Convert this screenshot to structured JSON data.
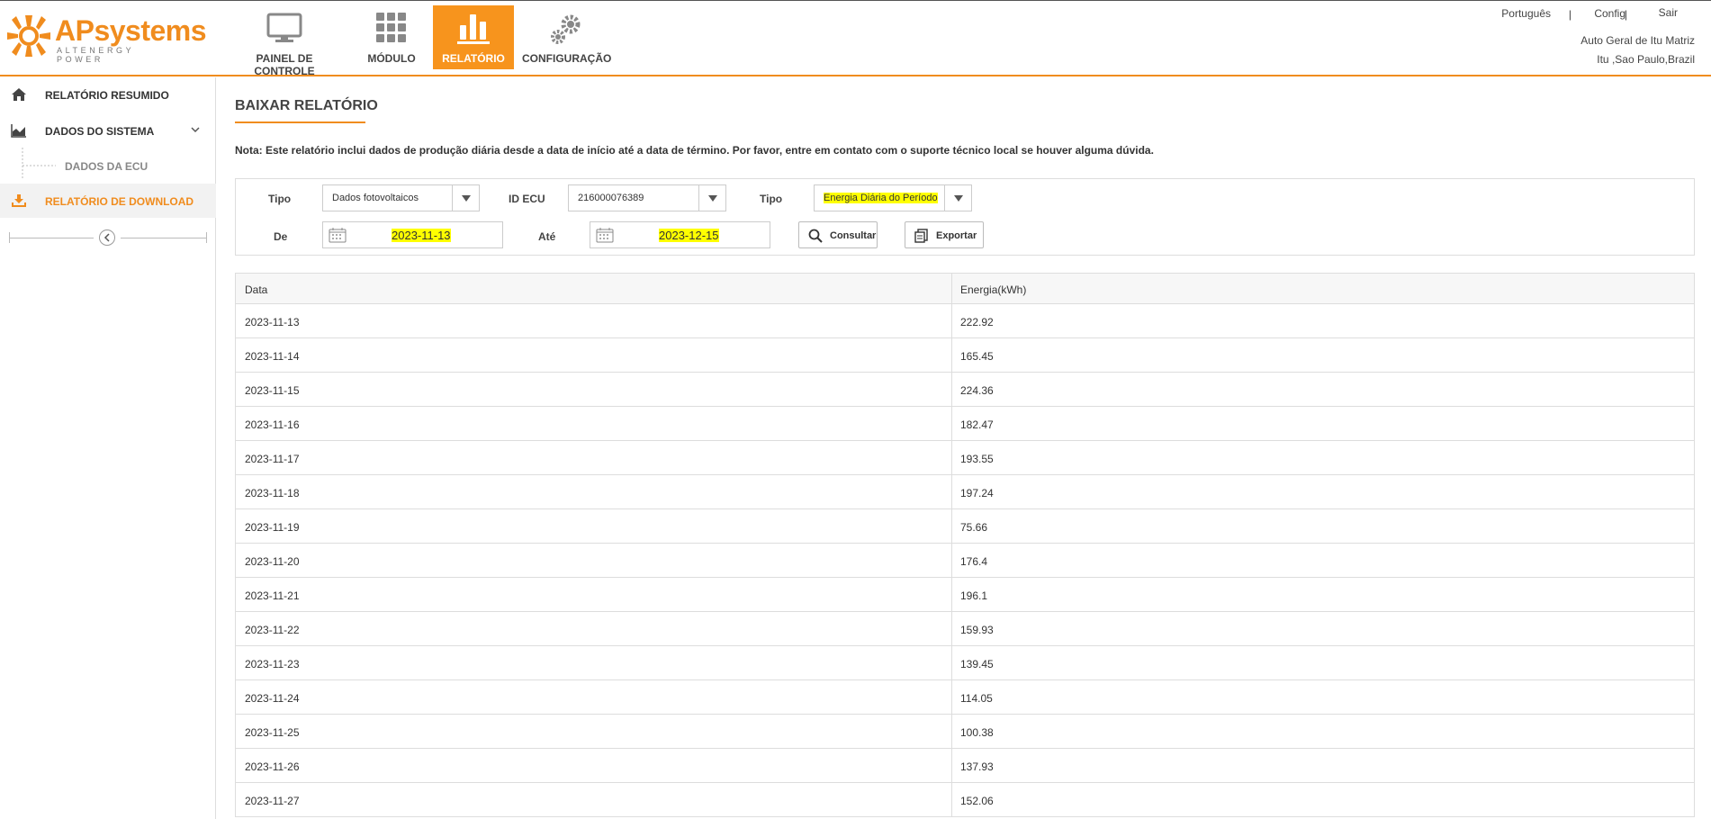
{
  "header": {
    "logo": {
      "brand_ap": "AP",
      "brand_rest": "systems",
      "tagline": "ALTENERGY POWER"
    },
    "nav": [
      {
        "label": "PAINEL DE CONTROLE",
        "icon": "monitor-icon"
      },
      {
        "label": "MÓDULO",
        "icon": "grid-icon"
      },
      {
        "label": "RELATÓRIO",
        "icon": "bar-chart-icon",
        "active": true
      },
      {
        "label": "CONFIGURAÇÃO",
        "icon": "gears-icon"
      }
    ],
    "language": "Português",
    "separator": "|",
    "config": "Config",
    "logout": "Sair",
    "site_name": "Auto Geral de Itu Matriz",
    "location": "Itu ,Sao Paulo,Brazil"
  },
  "sidebar": {
    "items": [
      {
        "label": "RELATÓRIO RESUMIDO",
        "icon": "home-icon"
      },
      {
        "label": "DADOS DO SISTEMA",
        "icon": "area-chart-icon"
      },
      {
        "label": "DADOS DA ECU"
      },
      {
        "label": "RELATÓRIO DE DOWNLOAD",
        "icon": "download-icon",
        "active": true
      }
    ],
    "collapse_icon": "chevron-left-icon"
  },
  "main": {
    "title": "BAIXAR RELATÓRIO",
    "note": "Nota: Este relatório inclui dados de produção diária desde a data de início até a data de término. Por favor, entre em contato com o suporte técnico local se houver alguma dúvida.",
    "filters": {
      "tipo1_label": "Tipo",
      "tipo1_value": "Dados fotovoltaicos",
      "ecu_label": "ID ECU",
      "ecu_value": "216000076389",
      "tipo2_label": "Tipo",
      "tipo2_value": "Energia Diária do Período",
      "from_label": "De",
      "from_value": "2023-11-13",
      "to_label": "Até",
      "to_value": "2023-12-15",
      "consult_label": "Consultar",
      "export_label": "Exportar"
    },
    "table": {
      "columns": [
        "Data",
        "Energia(kWh)"
      ],
      "rows": [
        [
          "2023-11-13",
          "222.92"
        ],
        [
          "2023-11-14",
          "165.45"
        ],
        [
          "2023-11-15",
          "224.36"
        ],
        [
          "2023-11-16",
          "182.47"
        ],
        [
          "2023-11-17",
          "193.55"
        ],
        [
          "2023-11-18",
          "197.24"
        ],
        [
          "2023-11-19",
          "75.66"
        ],
        [
          "2023-11-20",
          "176.4"
        ],
        [
          "2023-11-21",
          "196.1"
        ],
        [
          "2023-11-22",
          "159.93"
        ],
        [
          "2023-11-23",
          "139.45"
        ],
        [
          "2023-11-24",
          "114.05"
        ],
        [
          "2023-11-25",
          "100.38"
        ],
        [
          "2023-11-26",
          "137.93"
        ],
        [
          "2023-11-27",
          "152.06"
        ]
      ]
    }
  },
  "colors": {
    "accent": "#f08c1e",
    "highlight": "#ffff00"
  }
}
